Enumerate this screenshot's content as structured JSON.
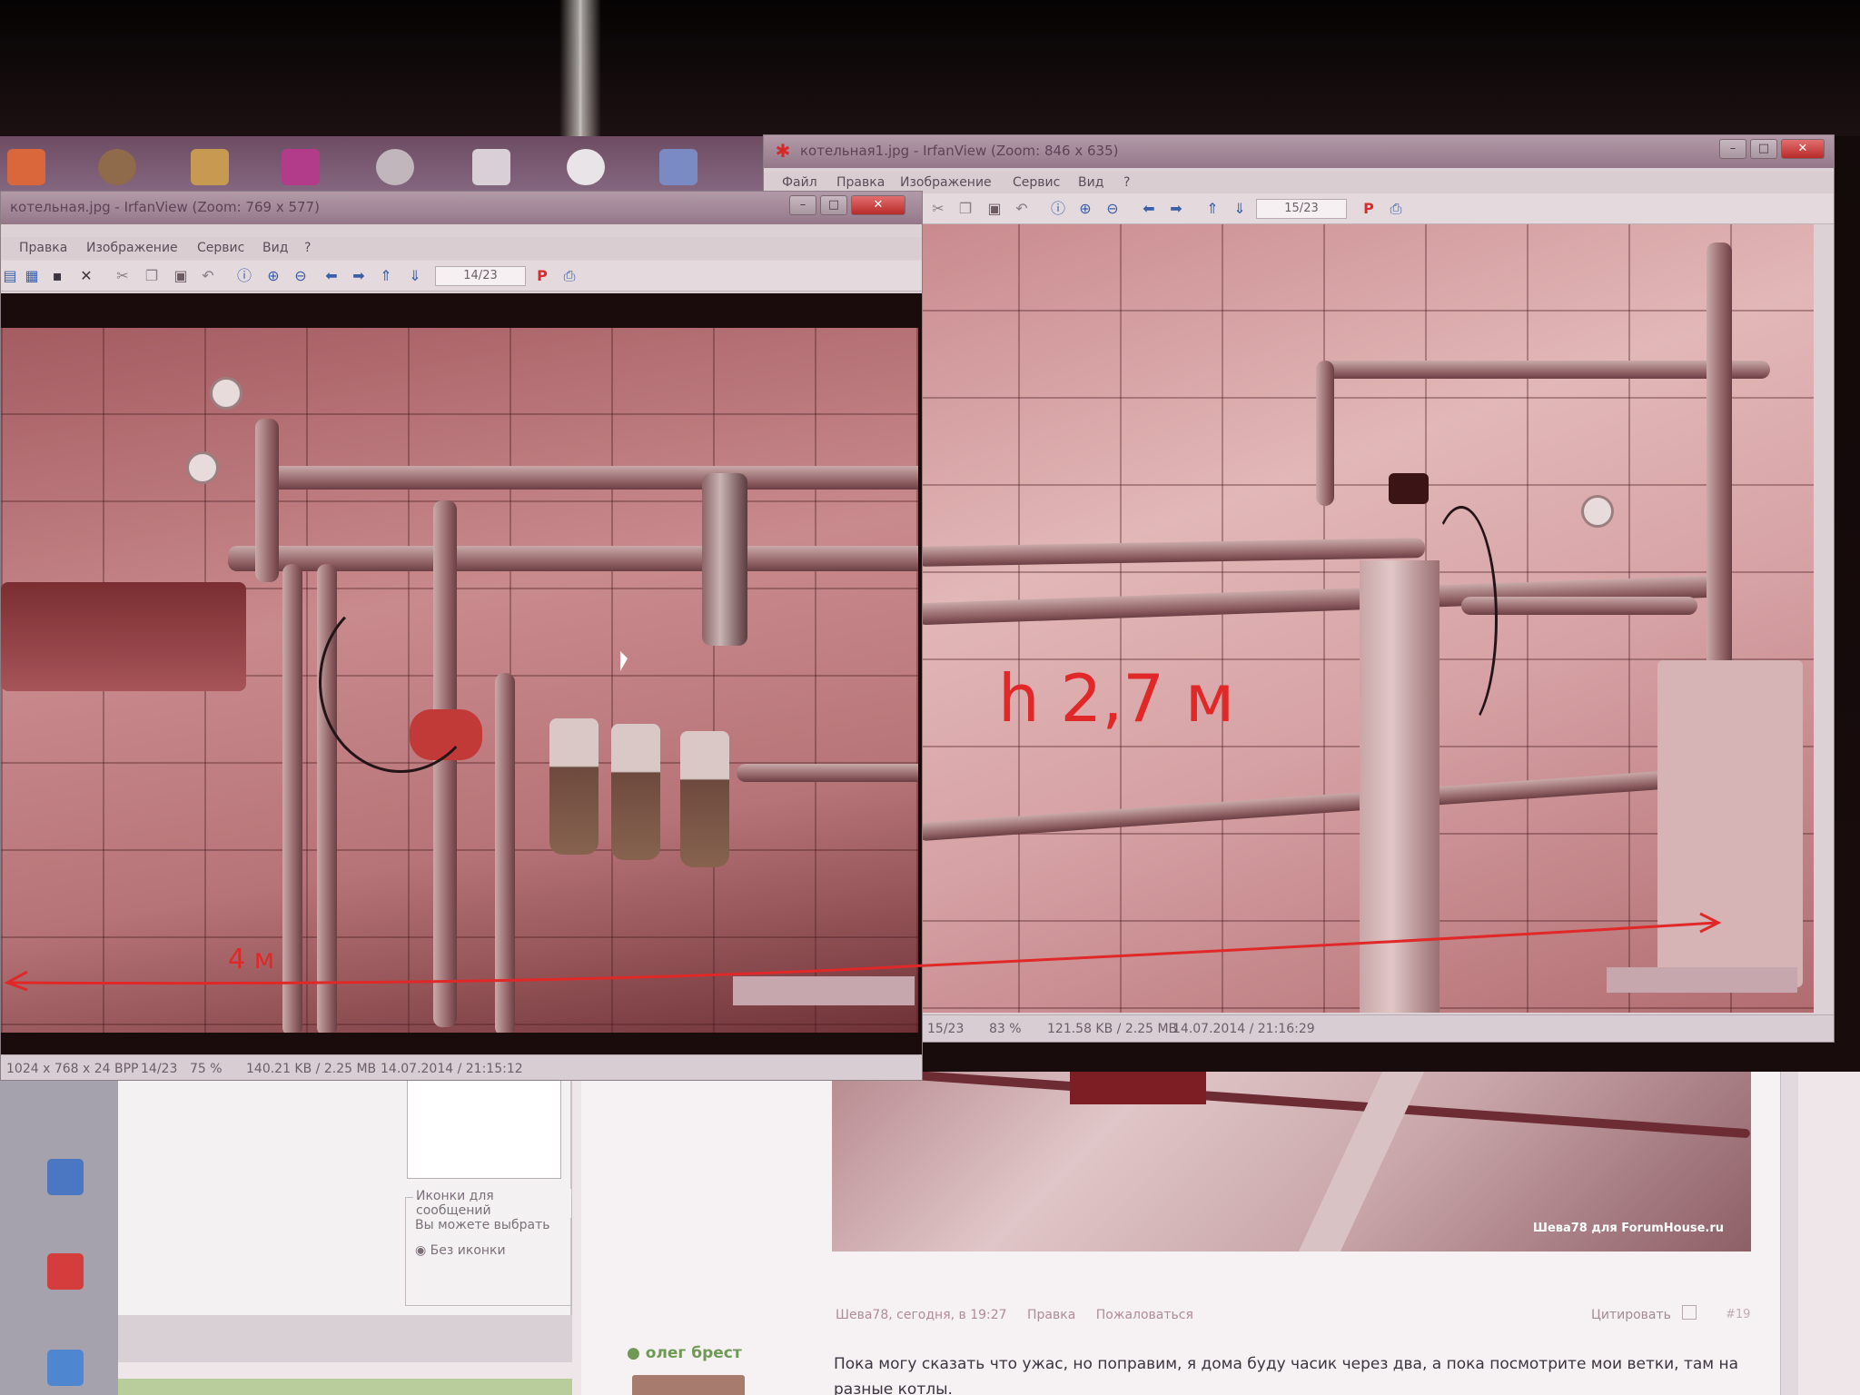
{
  "left_window": {
    "title": "котельная.jpg - IrfanView (Zoom: 769 x 577)",
    "menu": [
      "Правка",
      "Изображение",
      "Сервис",
      "Вид",
      "?"
    ],
    "counter": "14/23",
    "status": [
      "1024 x 768 x 24 BPP",
      "14/23",
      "75 %",
      "140.21 KB / 2.25 MB",
      "14.07.2014 / 21:15:12"
    ],
    "annotation": "4 м"
  },
  "right_window": {
    "title": "котельная1.jpg - IrfanView (Zoom: 846 x 635)",
    "menu": [
      "Файл",
      "Правка",
      "Изображение",
      "Сервис",
      "Вид",
      "?"
    ],
    "counter": "15/23",
    "status": [
      "15/23",
      "83 %",
      "121.58 KB / 2.25 MB",
      "14.07.2014 / 21:16:29"
    ],
    "annotation": "h 2,7 м"
  },
  "forum": {
    "icons_label": "Иконки для сообщений",
    "icons_hint": "Вы можете выбрать",
    "no_icon": "Без иконки",
    "photo_watermark": "Шева78 для ForumHouse.ru",
    "meta": [
      "Шева78, сегодня, в 19:27",
      "Правка",
      "Пожаловаться"
    ],
    "quote": "Цитировать",
    "post_number": "#19",
    "username": "олег брест",
    "post_text": "Пока могу сказать что ужас, но поправим, я дома буду часик через два, а пока посмотрите мои ветки, там на разные котлы."
  },
  "colors": {
    "annotation": "#e02828",
    "close_button": "#c93535",
    "user_name": "#6f9a56"
  }
}
